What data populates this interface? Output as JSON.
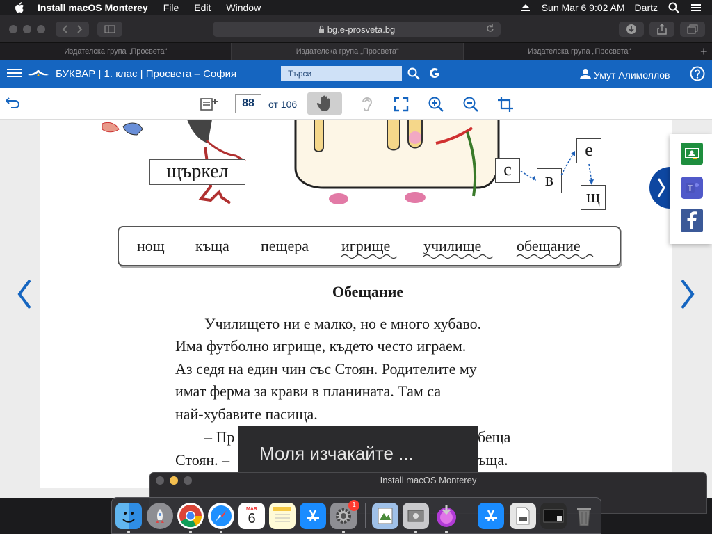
{
  "menubar": {
    "app_name": "Install macOS Monterey",
    "menus": [
      "File",
      "Edit",
      "Window"
    ],
    "datetime": "Sun Mar 6  9:02 AM",
    "user": "Dartz",
    "icons": [
      "apple-logo-icon",
      "eject-icon",
      "search-icon",
      "control-center-icon"
    ]
  },
  "browser": {
    "url": "bg.e-prosveta.bg",
    "tabs": [
      "Издателска група „Просвета“",
      "Издателска група „Просвета“",
      "Издателска група „Просвета“"
    ],
    "new_tab": "+"
  },
  "site": {
    "title": "БУКВАР | 1. клас | Просвета – София",
    "search_placeholder": "Търси",
    "user_name": "Умут Алимоллов",
    "header_bg": "#1565c0"
  },
  "reader": {
    "current_page": "88",
    "total_label": "от 106"
  },
  "page": {
    "picture_label": "щъркел",
    "letters": [
      "с",
      "в",
      "е",
      "щ"
    ],
    "words": [
      "нощ",
      "къща",
      "пещера",
      "игрище",
      "училище",
      "обещание"
    ],
    "title": "Обещание",
    "lines": [
      "Училището ни е малко, но е много хубаво.",
      "Има футболно игрище, където често играем.",
      "Аз седя на един чин със Стоян. Родителите му",
      "имат ферма за крави в планината. Там са",
      "най-хубавите пасища.",
      "– Пр",
      "беща",
      "Стоян. –",
      "ъща."
    ]
  },
  "toast": {
    "message": "Моля изчакайте ..."
  },
  "install_window": {
    "title": "Install macOS Monterey"
  },
  "dock": {
    "apps": [
      "finder",
      "launchpad",
      "chrome",
      "safari",
      "calendar",
      "notes",
      "app-store",
      "system-preferences",
      "preview",
      "disk-utility",
      "install-macos",
      "app-store",
      "file",
      "screenshot",
      "trash"
    ],
    "calendar_month": "MAR",
    "calendar_day": "6",
    "badge": "1"
  }
}
